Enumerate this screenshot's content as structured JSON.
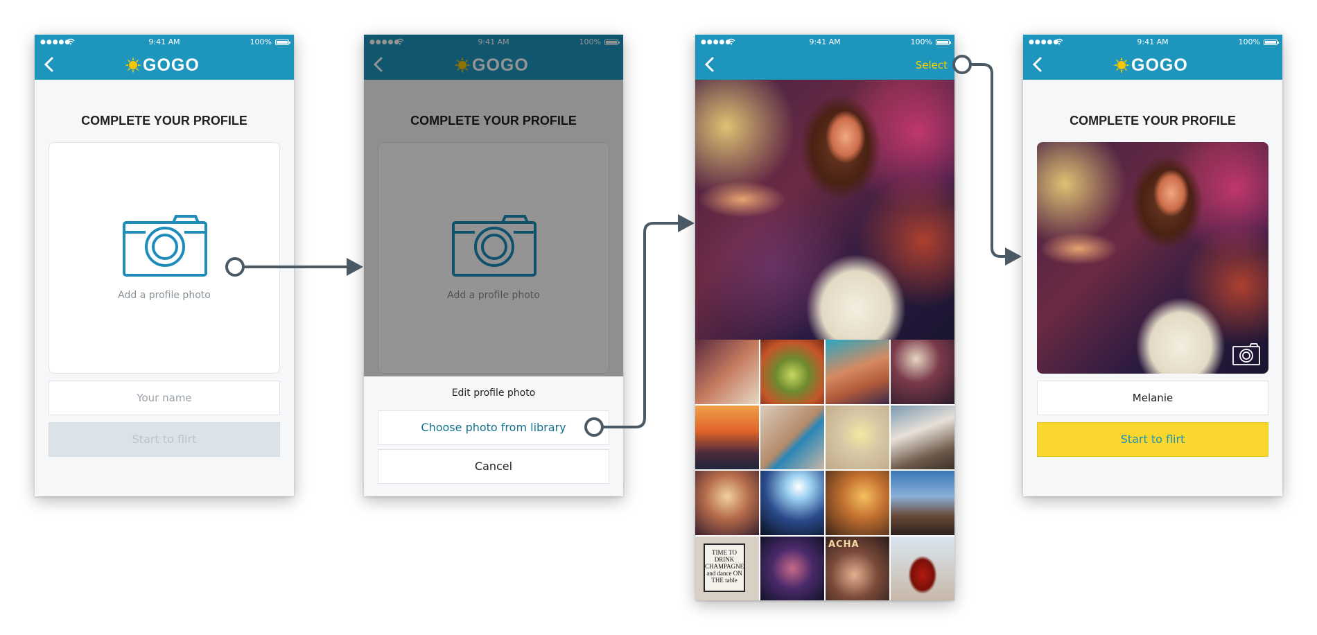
{
  "status_bar": {
    "time": "9:41 AM",
    "battery": "100%"
  },
  "brand": {
    "logo_text": "GOGO"
  },
  "screens": [
    {
      "title": "COMPLETE YOUR PROFILE",
      "photo_caption": "Add a profile photo",
      "name_placeholder": "Your name",
      "button_label": "Start to flirt"
    },
    {
      "title": "COMPLETE YOUR PROFILE",
      "photo_caption": "Add a profile photo",
      "sheet_title": "Edit profile photo",
      "choose_label": "Choose photo from library",
      "cancel_label": "Cancel"
    },
    {
      "select_label": "Select",
      "thumb_caption": "TIME TO DRINK CHAMPAGNE and dance ON THE table",
      "thumb_sign": "ACHA"
    },
    {
      "title": "COMPLETE YOUR PROFILE",
      "name_value": "Melanie",
      "button_label": "Start to flirt"
    }
  ],
  "colors": {
    "header_blue": "#1d95bd",
    "accent_yellow": "#fad72e",
    "select_yellow": "#f5d200",
    "link_blue": "#126f8e",
    "connector": "#4a5964"
  },
  "icons": [
    "back-chevron-icon",
    "sun-logo-icon",
    "camera-icon",
    "camera-small-icon"
  ]
}
